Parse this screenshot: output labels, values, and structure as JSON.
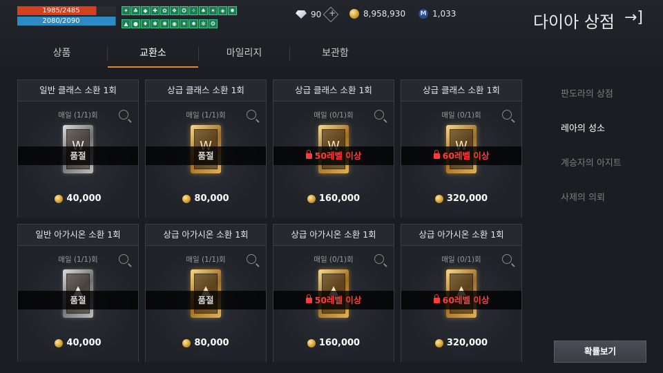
{
  "hud": {
    "hp_text": "1985/2485",
    "mp_text": "2080/2090",
    "hp_ratio": 0.8,
    "mp_ratio": 0.995,
    "buff_count": 22
  },
  "currency": {
    "diamond": "90",
    "gold": "8,958,930",
    "mileage": "1,033",
    "mileage_icon_letter": "M"
  },
  "shop_title": "다이아 상점",
  "exit_glyph": "→]",
  "tabs": [
    {
      "label": "상품"
    },
    {
      "label": "교환소"
    },
    {
      "label": "마일리지"
    },
    {
      "label": "보관함"
    }
  ],
  "active_tab": 1,
  "cards": [
    {
      "title": "일반 클래스 소환 1회",
      "limit": "매일 (1/1)회",
      "art": "silver",
      "emblem": "W",
      "status": "품절",
      "locked": false,
      "price": "40,000"
    },
    {
      "title": "상급 클래스 소환 1회",
      "limit": "매일 (1/1)회",
      "art": "gold",
      "emblem": "W",
      "status": "품절",
      "locked": false,
      "price": "80,000"
    },
    {
      "title": "상급 클래스 소환 1회",
      "limit": "매일 (0/1)회",
      "art": "gold",
      "emblem": "W",
      "status": "50레벨 이상",
      "locked": true,
      "price": "160,000"
    },
    {
      "title": "상급 클래스 소환 1회",
      "limit": "매일 (0/1)회",
      "art": "gold",
      "emblem": "W",
      "status": "60레벨 이상",
      "locked": true,
      "price": "320,000"
    },
    {
      "title": "일반 아가시온 소환 1회",
      "limit": "매일 (1/1)회",
      "art": "silver",
      "emblem": "▲",
      "status": "품절",
      "locked": false,
      "price": "40,000"
    },
    {
      "title": "상급 아가시온 소환 1회",
      "limit": "매일 (1/1)회",
      "art": "gold",
      "emblem": "▲",
      "status": "품절",
      "locked": false,
      "price": "80,000"
    },
    {
      "title": "상급 아가시온 소환 1회",
      "limit": "매일 (0/1)회",
      "art": "gold",
      "emblem": "▲",
      "status": "50레벨 이상",
      "locked": true,
      "price": "160,000"
    },
    {
      "title": "상급 아가시온 소환 1회",
      "limit": "매일 (0/1)회",
      "art": "gold",
      "emblem": "▲",
      "status": "60레벨 이상",
      "locked": true,
      "price": "320,000"
    }
  ],
  "side_menu": [
    {
      "label": "판도라의 상점"
    },
    {
      "label": "레아의 성소"
    },
    {
      "label": "계승자의 아지트"
    },
    {
      "label": "사제의 의뢰"
    }
  ],
  "active_side": 1,
  "probability_button": "확률보기",
  "colors": {
    "accent": "#d98a3a",
    "locked_red": "#ff3b3b",
    "hp": "#d2401f",
    "mp": "#2b8bc2"
  }
}
